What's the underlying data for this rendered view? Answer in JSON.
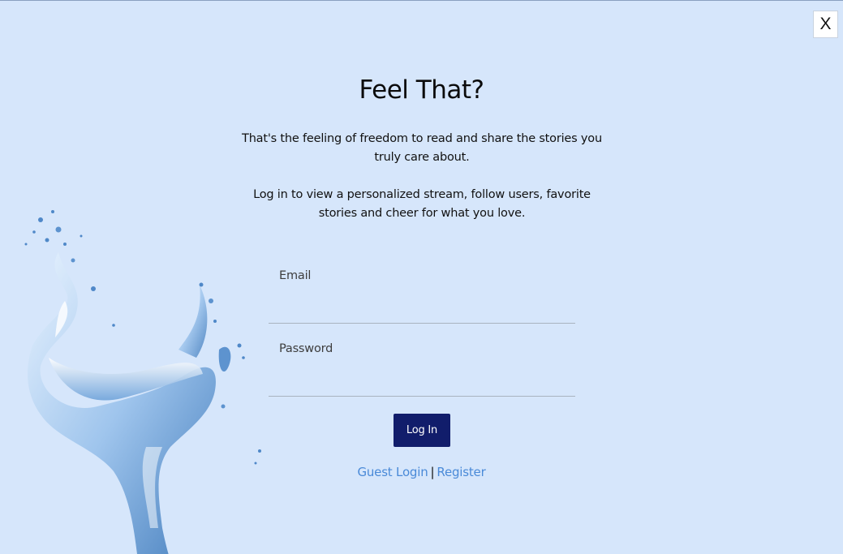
{
  "close_label": "X",
  "title": "Feel That?",
  "intro_text": "That's the feeling of freedom to read and share the stories you truly care about.",
  "login_text": "Log in to view a personalized stream, follow users, favorite stories and cheer for what you love.",
  "form": {
    "email_label": "Email",
    "email_value": "",
    "password_label": "Password",
    "password_value": "",
    "login_button": "Log In"
  },
  "links": {
    "guest_login": "Guest Login",
    "separator": "|",
    "register": "Register"
  },
  "colors": {
    "background": "#d6e6fb",
    "button": "#111d6b",
    "link": "#4a8ad8"
  },
  "decoration": "water-splash-image"
}
